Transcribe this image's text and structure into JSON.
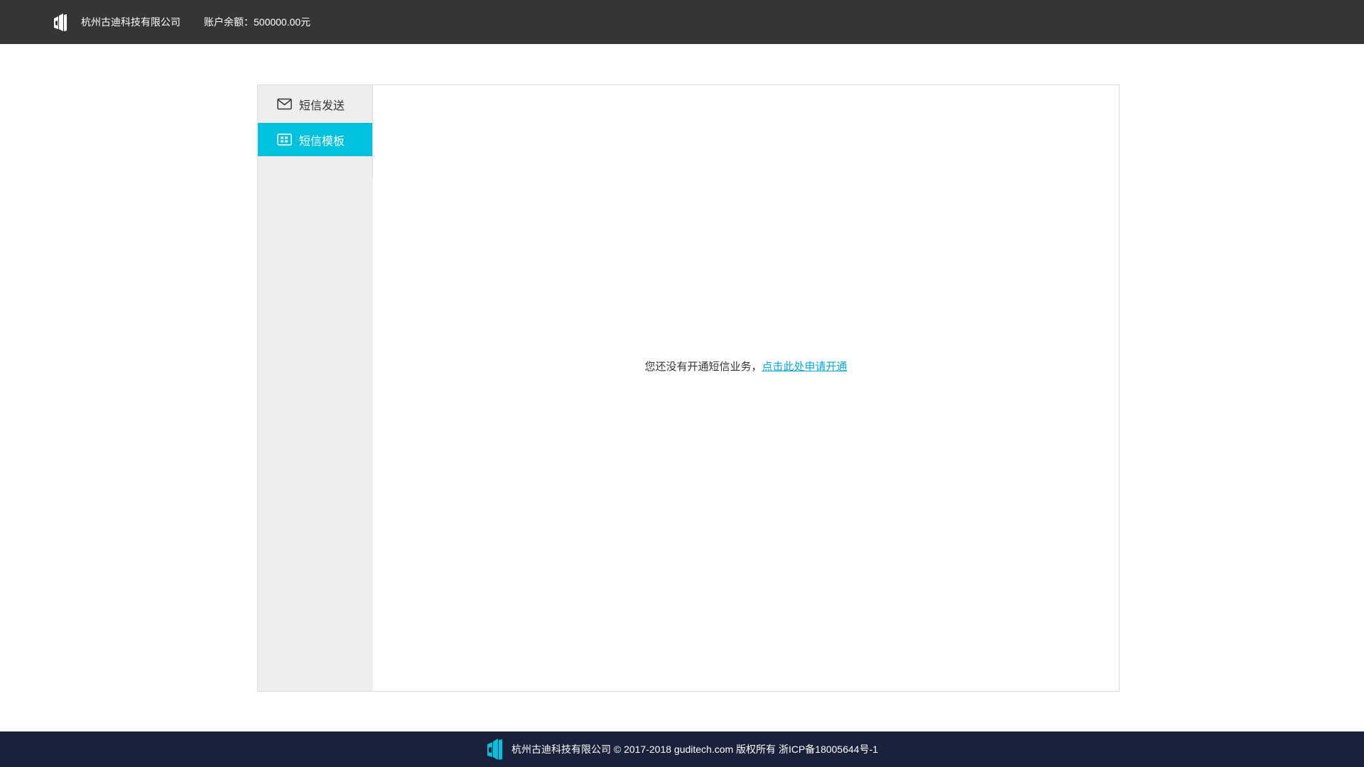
{
  "header": {
    "company_name": "杭州古迪科技有限公司",
    "balance_text": "账户余额：500000.00元",
    "logo_icon": "gudi-logo-icon"
  },
  "sidebar": {
    "items": [
      {
        "label": "短信发送",
        "icon": "envelope-icon",
        "active": false
      },
      {
        "label": "短信模板",
        "icon": "template-grid-icon",
        "active": true
      }
    ]
  },
  "main": {
    "notice_text": "您还没有开通短信业务，",
    "notice_link": "点击此处申请开通"
  },
  "footer": {
    "text": "杭州古迪科技有限公司 © 2017-2018 guditech.com 版权所有 浙ICP备18005644号-1",
    "logo_icon": "gudi-logo-icon"
  },
  "colors": {
    "topbar_bg": "#353535",
    "accent": "#00c1de",
    "link": "#00a8d8",
    "sidebar_bg": "#eeeeee",
    "footer_bg": "#19223a"
  }
}
